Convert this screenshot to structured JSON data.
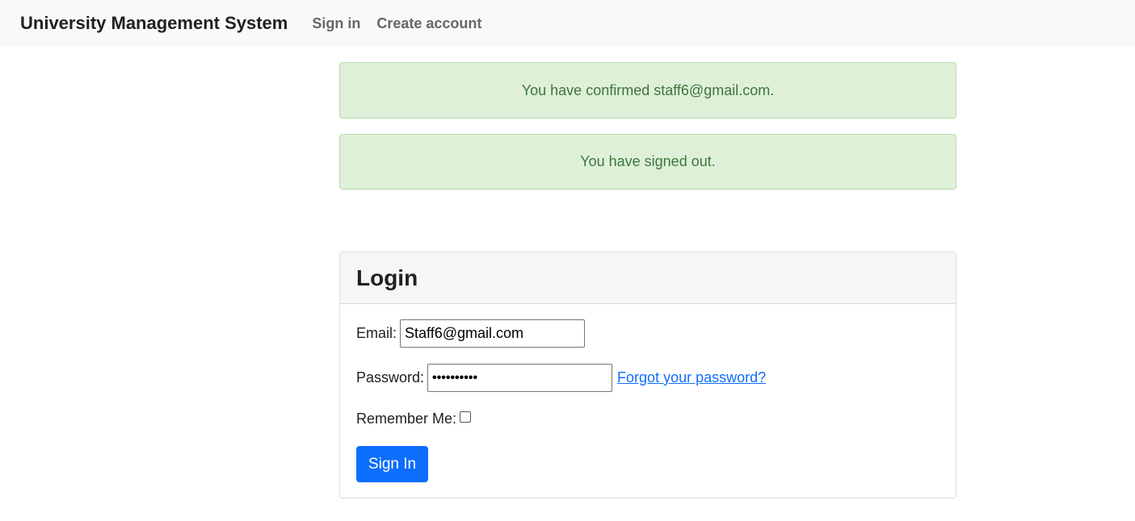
{
  "navbar": {
    "brand": "University Management System",
    "links": [
      {
        "label": "Sign in"
      },
      {
        "label": "Create account"
      }
    ]
  },
  "alerts": [
    {
      "text": "You have confirmed staff6@gmail.com."
    },
    {
      "text": "You have signed out."
    }
  ],
  "login": {
    "title": "Login",
    "email_label": "Email:",
    "email_value": "Staff6@gmail.com",
    "password_label": "Password:",
    "password_mask": "••••••••••",
    "forgot_link": "Forgot your password?",
    "remember_label": "Remember Me:",
    "remember_checked": false,
    "submit_label": "Sign In"
  },
  "colors": {
    "primary": "#0d6efd",
    "alert_bg": "#dff0d8",
    "alert_text": "#3c763d",
    "navbar_bg": "#f8f9fa"
  }
}
